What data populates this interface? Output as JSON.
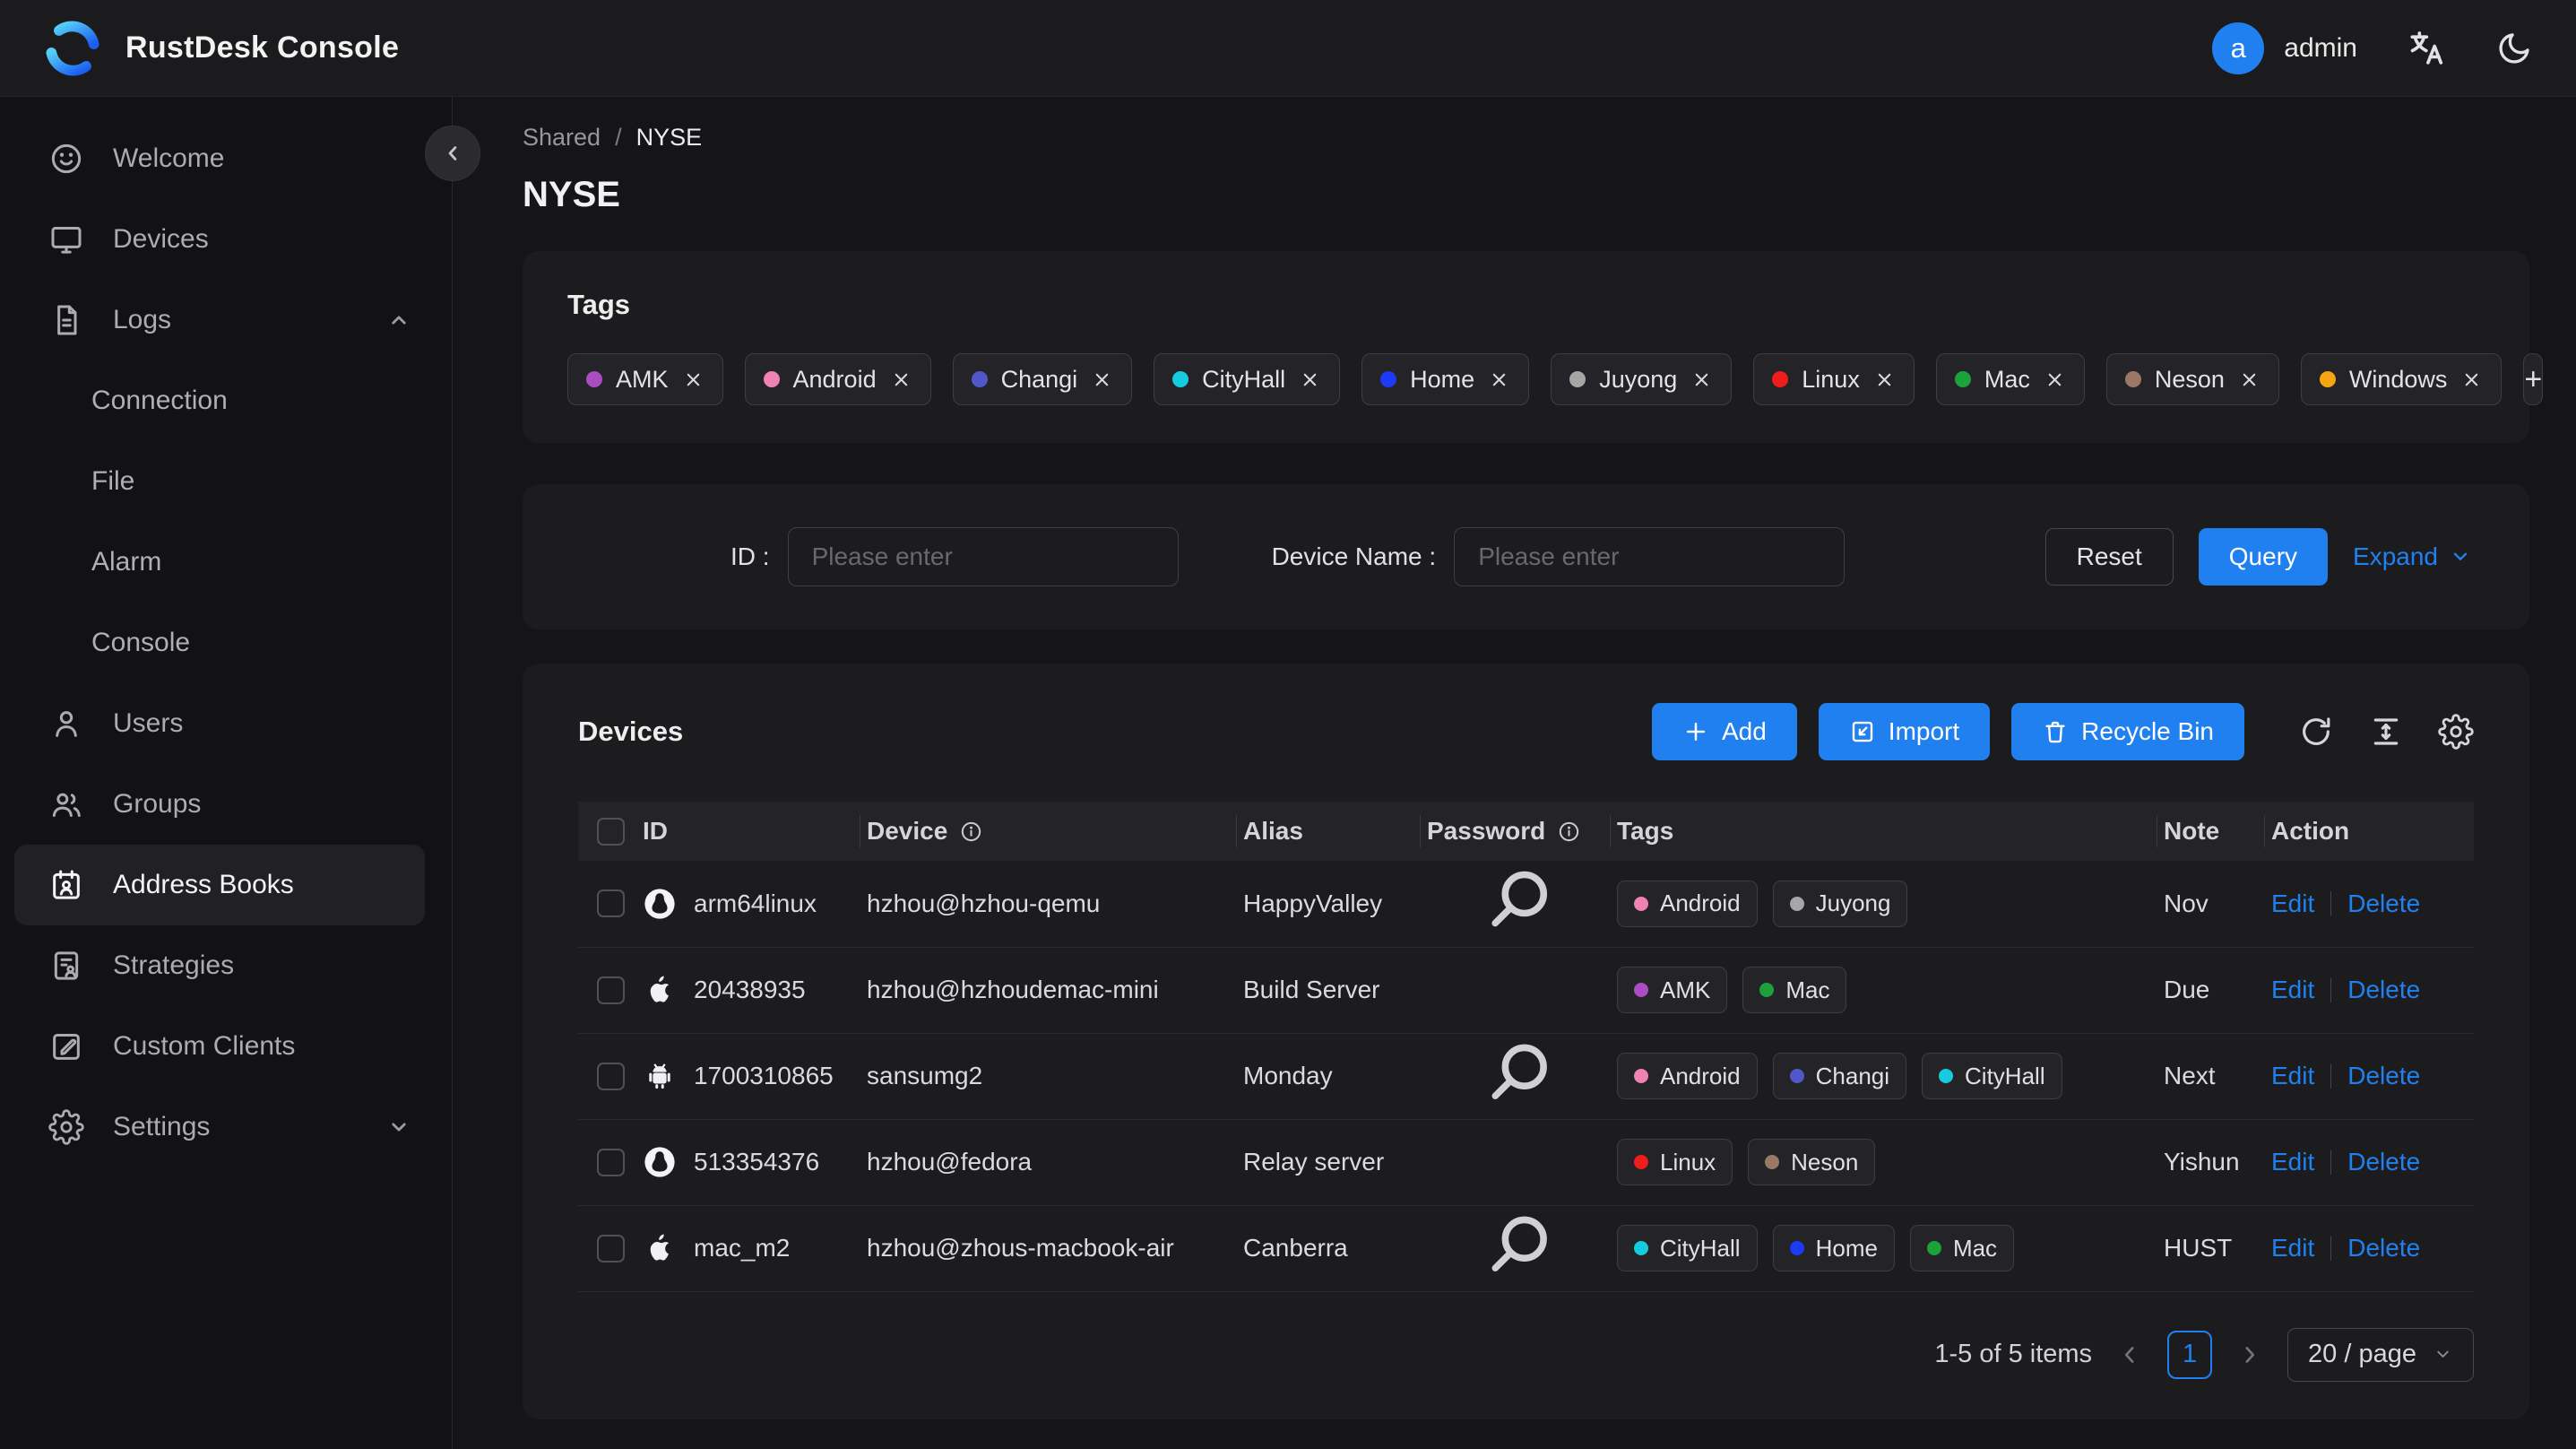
{
  "header": {
    "app_title": "RustDesk Console",
    "avatar_initial": "a",
    "username": "admin"
  },
  "sidebar": {
    "items": [
      {
        "label": "Welcome",
        "icon": "smiley"
      },
      {
        "label": "Devices",
        "icon": "monitor"
      },
      {
        "label": "Logs",
        "icon": "file-text",
        "chevron": "up",
        "children": [
          "Connection",
          "File",
          "Alarm",
          "Console"
        ]
      },
      {
        "label": "Users",
        "icon": "user"
      },
      {
        "label": "Groups",
        "icon": "users"
      },
      {
        "label": "Address Books",
        "icon": "address-book",
        "active": true
      },
      {
        "label": "Strategies",
        "icon": "strategy"
      },
      {
        "label": "Custom Clients",
        "icon": "edit-square"
      },
      {
        "label": "Settings",
        "icon": "gear",
        "chevron": "down"
      }
    ]
  },
  "breadcrumb": {
    "parent": "Shared",
    "separator": "/",
    "current": "NYSE"
  },
  "page_title": "NYSE",
  "tags_card": {
    "title": "Tags",
    "tags": [
      "AMK",
      "Android",
      "Changi",
      "CityHall",
      "Home",
      "Juyong",
      "Linux",
      "Mac",
      "Neson",
      "Windows"
    ],
    "add_label": "+"
  },
  "tag_colors": {
    "AMK": "#ab4cc3",
    "Android": "#ef82b4",
    "Changi": "#5157ca",
    "CityHall": "#16cbe0",
    "Home": "#1b3bf5",
    "Juyong": "#a6a6a6",
    "Linux": "#f11c1c",
    "Mac": "#1ba23a",
    "Neson": "#9b7767",
    "Windows": "#f7a413"
  },
  "filter": {
    "id_label": "ID :",
    "id_placeholder": "Please enter",
    "device_name_label": "Device Name :",
    "device_name_placeholder": "Please enter",
    "reset_label": "Reset",
    "query_label": "Query",
    "expand_label": "Expand"
  },
  "devices_card": {
    "title": "Devices",
    "add_label": "Add",
    "import_label": "Import",
    "recycle_bin_label": "Recycle Bin",
    "columns": [
      {
        "key": "id",
        "label": "ID",
        "info": false
      },
      {
        "key": "device",
        "label": "Device",
        "info": true
      },
      {
        "key": "alias",
        "label": "Alias",
        "info": false
      },
      {
        "key": "password",
        "label": "Password",
        "info": true
      },
      {
        "key": "tags",
        "label": "Tags",
        "info": false
      },
      {
        "key": "note",
        "label": "Note",
        "info": false
      },
      {
        "key": "action",
        "label": "Action",
        "info": false
      }
    ],
    "edit_label": "Edit",
    "delete_label": "Delete",
    "rows": [
      {
        "os": "linux",
        "id": "arm64linux",
        "device": "hzhou@hzhou-qemu",
        "alias": "HappyValley",
        "has_password_search": true,
        "tags": [
          "Android",
          "Juyong"
        ],
        "note": "Nov"
      },
      {
        "os": "apple",
        "id": "20438935",
        "device": "hzhou@hzhoudemac-mini",
        "alias": "Build Server",
        "has_password_search": false,
        "tags": [
          "AMK",
          "Mac"
        ],
        "note": "Due"
      },
      {
        "os": "android",
        "id": "1700310865",
        "device": "sansumg2",
        "alias": "Monday",
        "has_password_search": true,
        "tags": [
          "Android",
          "Changi",
          "CityHall"
        ],
        "note": "Next"
      },
      {
        "os": "linux",
        "id": "513354376",
        "device": "hzhou@fedora",
        "alias": "Relay server",
        "has_password_search": false,
        "tags": [
          "Linux",
          "Neson"
        ],
        "note": "Yishun"
      },
      {
        "os": "apple",
        "id": "mac_m2",
        "device": "hzhou@zhous-macbook-air",
        "alias": "Canberra",
        "has_password_search": true,
        "tags": [
          "CityHall",
          "Home",
          "Mac"
        ],
        "note": "HUST"
      }
    ],
    "pagination": {
      "summary": "1-5 of 5 items",
      "current_page": "1",
      "page_size": "20 / page"
    }
  }
}
